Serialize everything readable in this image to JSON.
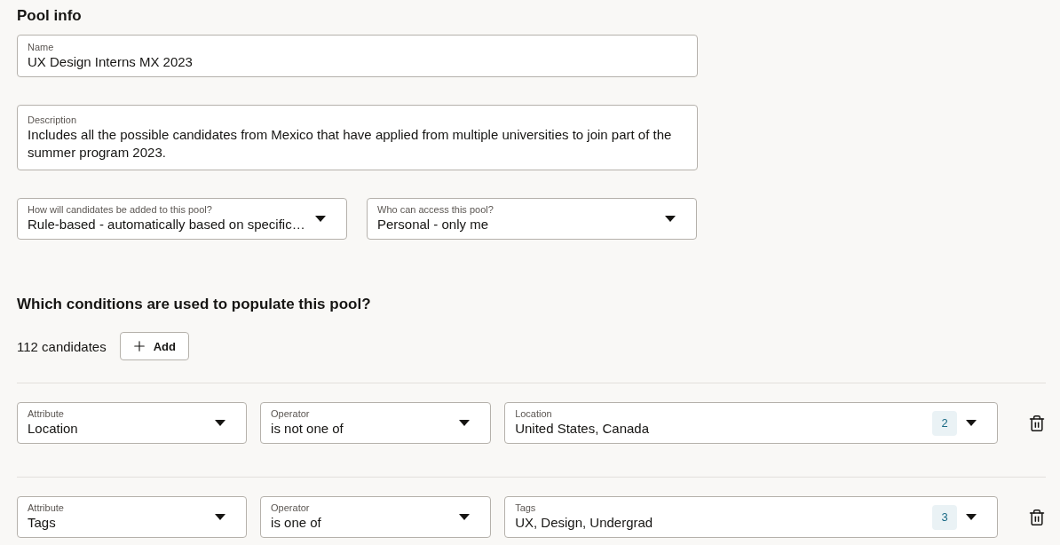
{
  "section_title": "Pool info",
  "name_field": {
    "label": "Name",
    "value": "UX Design Interns MX 2023"
  },
  "description_field": {
    "label": "Description",
    "value": "Includes all the possible candidates from Mexico that have applied from multiple universities to join part of the summer program 2023."
  },
  "selects": [
    {
      "label": "How will candidates be added to this pool?",
      "value": "Rule-based - automatically based on specific…"
    },
    {
      "label": "Who can access this pool?",
      "value": "Personal - only me"
    }
  ],
  "conditions_title": "Which conditions are used to populate this pool?",
  "candidate_count": "112 candidates",
  "add_button": "Add",
  "conditions": [
    {
      "attribute": {
        "label": "Attribute",
        "value": "Location"
      },
      "operator": {
        "label": "Operator",
        "value": "is not one of"
      },
      "values": {
        "label": "Location",
        "value": "United States, Canada",
        "count": "2"
      }
    },
    {
      "attribute": {
        "label": "Attribute",
        "value": "Tags"
      },
      "operator": {
        "label": "Operator",
        "value": "is one of"
      },
      "values": {
        "label": "Tags",
        "value": "UX, Design, Undergrad",
        "count": "3"
      }
    }
  ]
}
